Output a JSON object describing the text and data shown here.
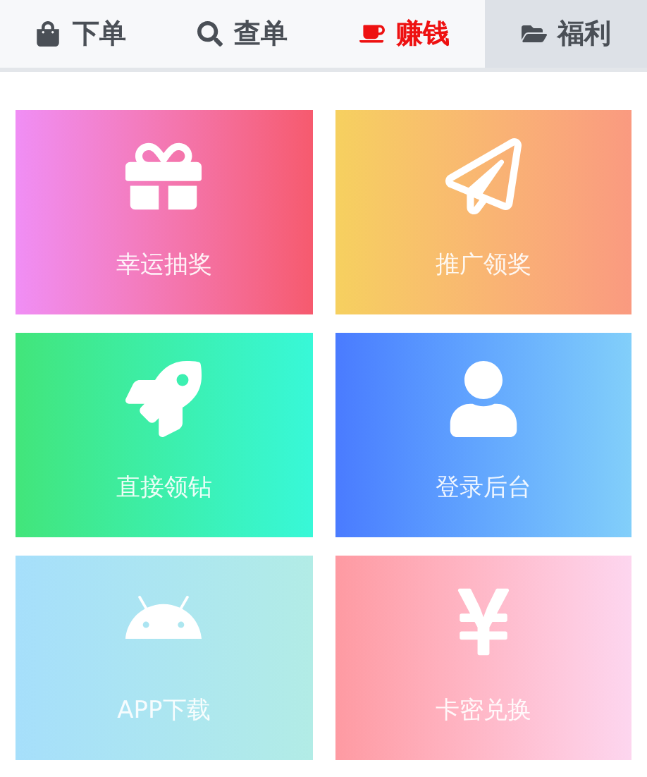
{
  "tabs": [
    {
      "label": "下单",
      "selected": false,
      "hot": false
    },
    {
      "label": "查单",
      "selected": false,
      "hot": false
    },
    {
      "label": "赚钱",
      "selected": false,
      "hot": true
    },
    {
      "label": "福利",
      "selected": true,
      "hot": false
    }
  ],
  "tiles": [
    {
      "label": "幸运抽奖"
    },
    {
      "label": "推广领奖"
    },
    {
      "label": "直接领钻"
    },
    {
      "label": "登录后台"
    },
    {
      "label": "APP下载"
    },
    {
      "label": "卡密兑换"
    }
  ]
}
